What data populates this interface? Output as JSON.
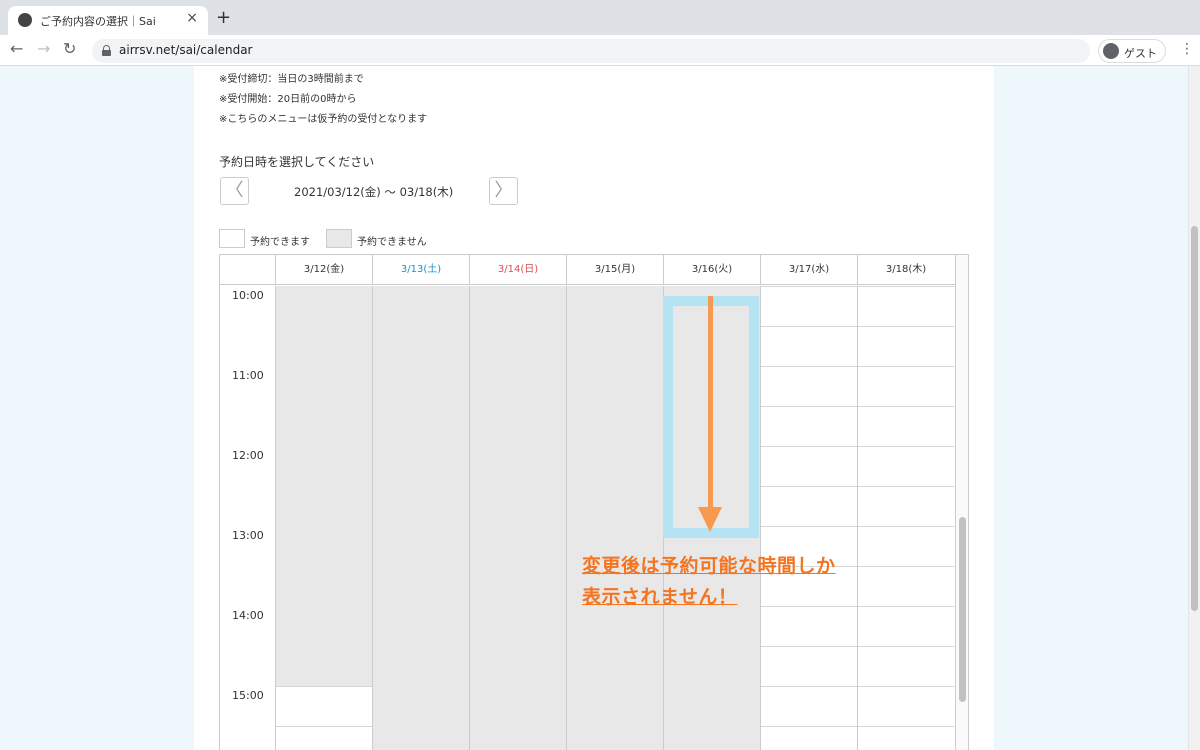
{
  "browser": {
    "tab_title": "ご予約内容の選択｜Sai",
    "url": "airrsv.net/sai/calendar",
    "profile_label": "ゲスト",
    "close_glyph": "×",
    "new_tab_glyph": "+",
    "back_glyph": "←",
    "forward_glyph": "→",
    "reload_glyph": "↻",
    "menu_glyph": "⋮"
  },
  "notes": [
    "※受付締切：当日の3時間前まで",
    "※受付開始：20日前の0時から",
    "※こちらのメニューは仮予約の受付となります"
  ],
  "section_title": "予約日時を選択してください",
  "week_nav": {
    "prev_glyph": "〈",
    "next_glyph": "〉",
    "range_label": "2021/03/12(金) 〜 03/18(木)"
  },
  "legend": {
    "available_label": "予約できます",
    "unavailable_label": "予約できません"
  },
  "calendar": {
    "days": [
      {
        "label": "3/12(金)",
        "color": "#333333",
        "unavailable_until_slot": 10
      },
      {
        "label": "3/13(土)",
        "color": "#1b8fc8",
        "unavailable_until_slot": 99
      },
      {
        "label": "3/14(日)",
        "color": "#e14b4b",
        "unavailable_until_slot": 99
      },
      {
        "label": "3/15(月)",
        "color": "#333333",
        "unavailable_until_slot": 99
      },
      {
        "label": "3/16(火)",
        "color": "#333333",
        "unavailable_until_slot": 99
      },
      {
        "label": "3/17(水)",
        "color": "#333333",
        "unavailable_until_slot": 0
      },
      {
        "label": "3/18(木)",
        "color": "#333333",
        "unavailable_until_slot": 0
      }
    ],
    "times": [
      "10:00",
      "11:00",
      "12:00",
      "13:00",
      "14:00",
      "15:00"
    ]
  },
  "annotation": {
    "line1": "変更後は予約可能な時間しか",
    "line2": "表示されません！",
    "color": "#f5741f"
  }
}
